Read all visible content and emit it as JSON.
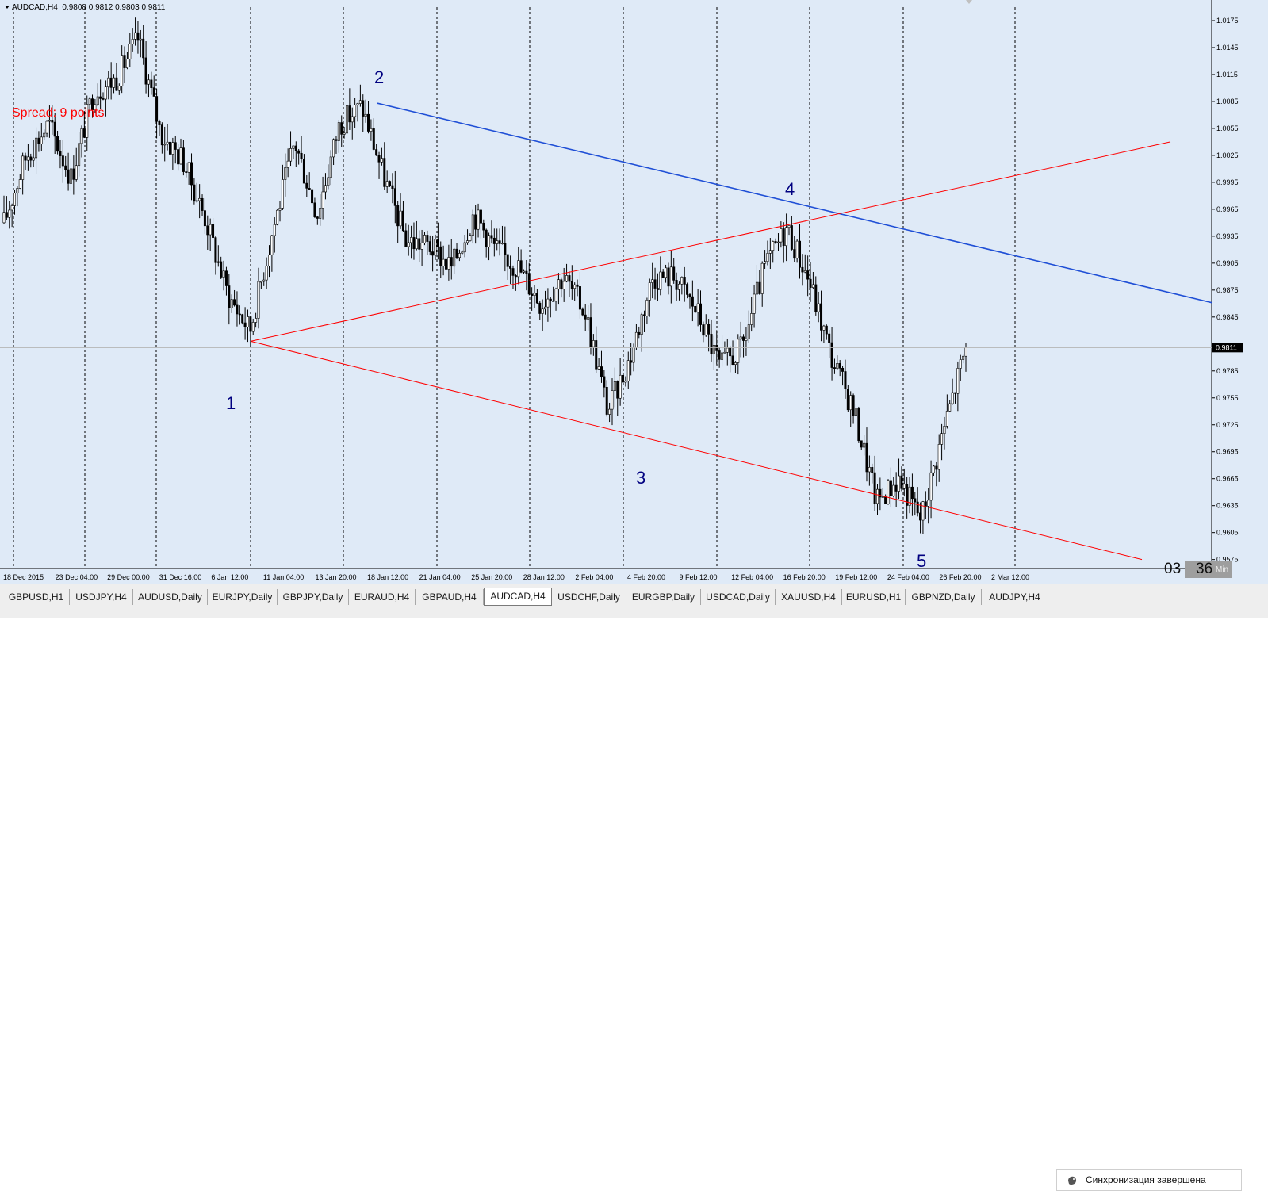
{
  "header": {
    "symbol": "AUDCAD,H4",
    "prices": "0.9808 0.9812 0.9803 0.9811"
  },
  "spread_label": "Spread: 9 points",
  "timer": {
    "minutes": "03",
    "seconds": "36",
    "unit": "Min"
  },
  "wave_labels": [
    "1",
    "2",
    "3",
    "4",
    "5"
  ],
  "tabs": [
    "GBPUSD,H1",
    "USDJPY,H4",
    "AUDUSD,Daily",
    "EURJPY,Daily",
    "GBPJPY,Daily",
    "EURAUD,H4",
    "GBPAUD,H4",
    "AUDCAD,H4",
    "USDCHF,Daily",
    "EURGBP,Daily",
    "USDCAD,Daily",
    "XAUUSD,H4",
    "EURUSD,H1",
    "GBPNZD,Daily",
    "AUDJPY,H4"
  ],
  "active_tab": "AUDCAD,H4",
  "sync_status": "Синхронизация завершена",
  "colors": {
    "background": "#dfeaf7",
    "candle": "#000000",
    "channel_upper": "#1f4fd6",
    "channel_lower": "#ff0000",
    "price_marker": "#000000"
  },
  "chart_data": {
    "type": "candlestick",
    "symbol": "AUDCAD",
    "timeframe": "H4",
    "current_price": "0.9811",
    "ylim": [
      0.9565,
      1.019
    ],
    "yticks": [
      "1.0175",
      "1.0145",
      "1.0115",
      "1.0085",
      "1.0055",
      "1.0025",
      "0.9995",
      "0.9965",
      "0.9935",
      "0.9905",
      "0.9875",
      "0.9845",
      "0.9811",
      "0.9785",
      "0.9755",
      "0.9725",
      "0.9695",
      "0.9665",
      "0.9635",
      "0.9605",
      "0.9575"
    ],
    "xticks": [
      "18 Dec 2015",
      "23 Dec 04:00",
      "29 Dec 00:00",
      "31 Dec 16:00",
      "6 Jan 12:00",
      "11 Jan 04:00",
      "13 Jan 20:00",
      "18 Jan 12:00",
      "21 Jan 04:00",
      "25 Jan 20:00",
      "28 Jan 12:00",
      "2 Feb 04:00",
      "4 Feb 20:00",
      "9 Feb 12:00",
      "12 Feb 04:00",
      "16 Feb 20:00",
      "19 Feb 12:00",
      "24 Feb 04:00",
      "26 Feb 20:00",
      "2 Mar 12:00"
    ],
    "close_path": [
      [
        "18 Dec 2015",
        0.995
      ],
      [
        "21 Dec 2015",
        1.0025
      ],
      [
        "23 Dec 04:00",
        1.006
      ],
      [
        "24 Dec 2015",
        1.0
      ],
      [
        "28 Dec 2015",
        1.0095
      ],
      [
        "29 Dec 00:00",
        1.011
      ],
      [
        "30 Dec 2015",
        1.0155
      ],
      [
        "31 Dec 16:00",
        1.005
      ],
      [
        "4 Jan 2016",
        1.002
      ],
      [
        "6 Jan 12:00",
        0.9955
      ],
      [
        "8 Jan 2016",
        0.987
      ],
      [
        "11 Jan 04:00",
        0.983
      ],
      [
        "12 Jan 2016",
        0.994
      ],
      [
        "13 Jan 20:00",
        1.004
      ],
      [
        "15 Jan 2016",
        0.996
      ],
      [
        "18 Jan 12:00",
        1.006
      ],
      [
        "19 Jan 2016",
        1.008
      ],
      [
        "21 Jan 04:00",
        1.0
      ],
      [
        "22 Jan 2016",
        0.993
      ],
      [
        "25 Jan 20:00",
        0.9925
      ],
      [
        "27 Jan 2016",
        0.99
      ],
      [
        "28 Jan 12:00",
        0.996
      ],
      [
        "1 Feb 2016",
        0.992
      ],
      [
        "2 Feb 04:00",
        0.99
      ],
      [
        "3 Feb 2016",
        0.986
      ],
      [
        "4 Feb 20:00",
        0.989
      ],
      [
        "5 Feb 2016",
        0.985
      ],
      [
        "8 Feb 2016",
        0.974
      ],
      [
        "9 Feb 12:00",
        0.98
      ],
      [
        "10 Feb 2016",
        0.989
      ],
      [
        "12 Feb 04:00",
        0.989
      ],
      [
        "15 Feb 2016",
        0.985
      ],
      [
        "16 Feb 20:00",
        0.979
      ],
      [
        "17 Feb 2016",
        0.981
      ],
      [
        "19 Feb 12:00",
        0.99
      ],
      [
        "22 Feb 2016",
        0.9945
      ],
      [
        "23 Feb 2016",
        0.9885
      ],
      [
        "24 Feb 04:00",
        0.98
      ],
      [
        "25 Feb 2016",
        0.974
      ],
      [
        "26 Feb 20:00",
        0.964
      ],
      [
        "29 Feb 2016",
        0.9665
      ],
      [
        "1 Mar 2016",
        0.962
      ],
      [
        "2 Mar 12:00",
        0.972
      ],
      [
        "3 Mar 2016",
        0.9811
      ]
    ],
    "key_points": [
      {
        "label": "1",
        "price": 0.9818
      },
      {
        "label": "2",
        "price": 1.0083
      },
      {
        "label": "3",
        "price": 0.971
      },
      {
        "label": "4",
        "price": 0.996
      },
      {
        "label": "5",
        "price": 0.96
      }
    ],
    "trendlines": [
      {
        "name": "upper-blue",
        "color": "#1f4fd6",
        "start_price": 1.0083,
        "end_price": 0.9861
      },
      {
        "name": "lower-red-rising",
        "color": "#ff0000",
        "start_price": 0.9818,
        "end_price": 1.004
      },
      {
        "name": "lower-red-falling",
        "color": "#ff0000",
        "start_price": 0.9818,
        "end_price": 0.9575
      }
    ],
    "grid": true
  }
}
